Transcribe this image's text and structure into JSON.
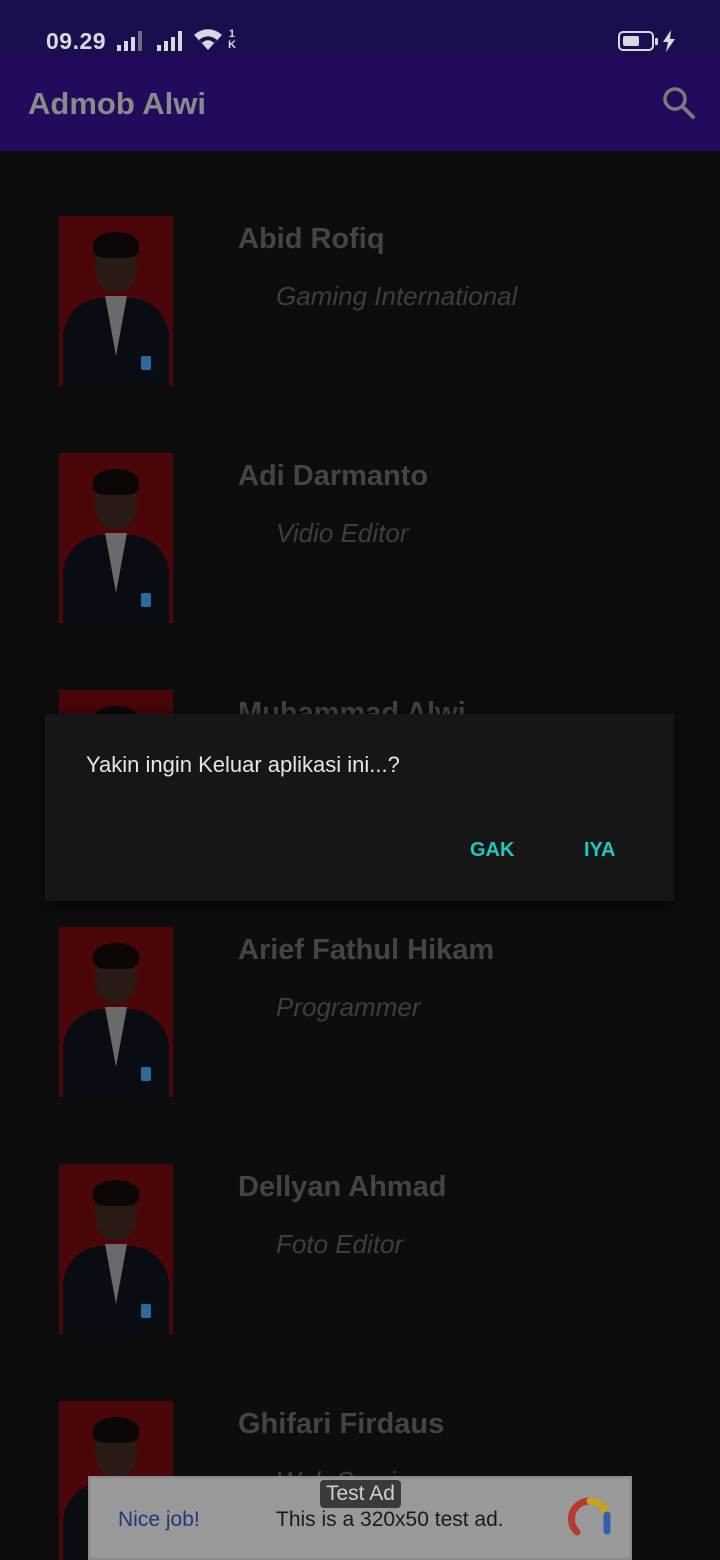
{
  "status_bar": {
    "time": "09.29",
    "net_rate_top": "1",
    "net_rate_bottom": "K",
    "battery_level": 0.6
  },
  "app_bar": {
    "title": "Admob Alwi",
    "search_icon": "search-icon"
  },
  "list": {
    "items": [
      {
        "name": "Abid Rofiq",
        "role": "Gaming International"
      },
      {
        "name": "Adi Darmanto",
        "role": "Vidio Editor"
      },
      {
        "name": "Muhammad Alwi",
        "role": ""
      },
      {
        "name": "Arief Fathul Hikam",
        "role": "Programmer"
      },
      {
        "name": "Dellyan Ahmad",
        "role": "Foto Editor"
      },
      {
        "name": "Ghifari Firdaus",
        "role": "Web Service"
      }
    ]
  },
  "dialog": {
    "message": "Yakin ingin Keluar aplikasi ini...?",
    "negative_label": "GAK",
    "positive_label": "IYA"
  },
  "ad_banner": {
    "tag": "Test Ad",
    "headline": "Nice job!",
    "description": "This is a 320x50 test ad."
  },
  "colors": {
    "status_bar": "#1a0f4e",
    "app_bar": "#220a5c",
    "dialog_button": "#1fc7bd",
    "photo_background": "#4a0608"
  }
}
